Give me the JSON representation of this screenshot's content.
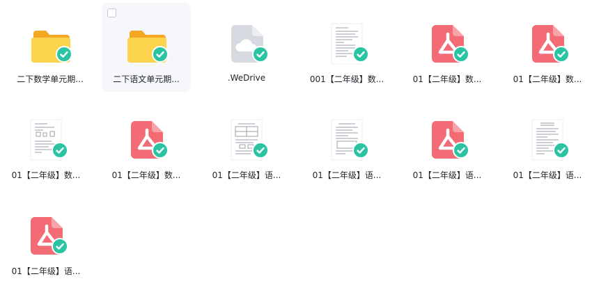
{
  "files": [
    {
      "name": "二下数学单元期...",
      "type": "folder"
    },
    {
      "name": "二下语文单元期...",
      "type": "folder"
    },
    {
      "name": ".WeDrive",
      "type": "cloud"
    },
    {
      "name": "001【二年级】数...",
      "type": "doc"
    },
    {
      "name": "01【二年级】数...",
      "type": "pdf"
    },
    {
      "name": "01【二年级】数...",
      "type": "pdf"
    },
    {
      "name": "01【二年级】数...",
      "type": "doc"
    },
    {
      "name": "01【二年级】数...",
      "type": "pdf"
    },
    {
      "name": "01【二年级】语...",
      "type": "doc"
    },
    {
      "name": "01【二年级】语...",
      "type": "doc"
    },
    {
      "name": "01【二年级】语...",
      "type": "pdf"
    },
    {
      "name": "01【二年级】语...",
      "type": "doc"
    },
    {
      "name": "01【二年级】语...",
      "type": "pdf"
    }
  ],
  "colors": {
    "folder": "#f7be2a",
    "pdf": "#f26b75",
    "sync_check": "#2bc4a3",
    "cloud_file": "#d6dae0"
  }
}
